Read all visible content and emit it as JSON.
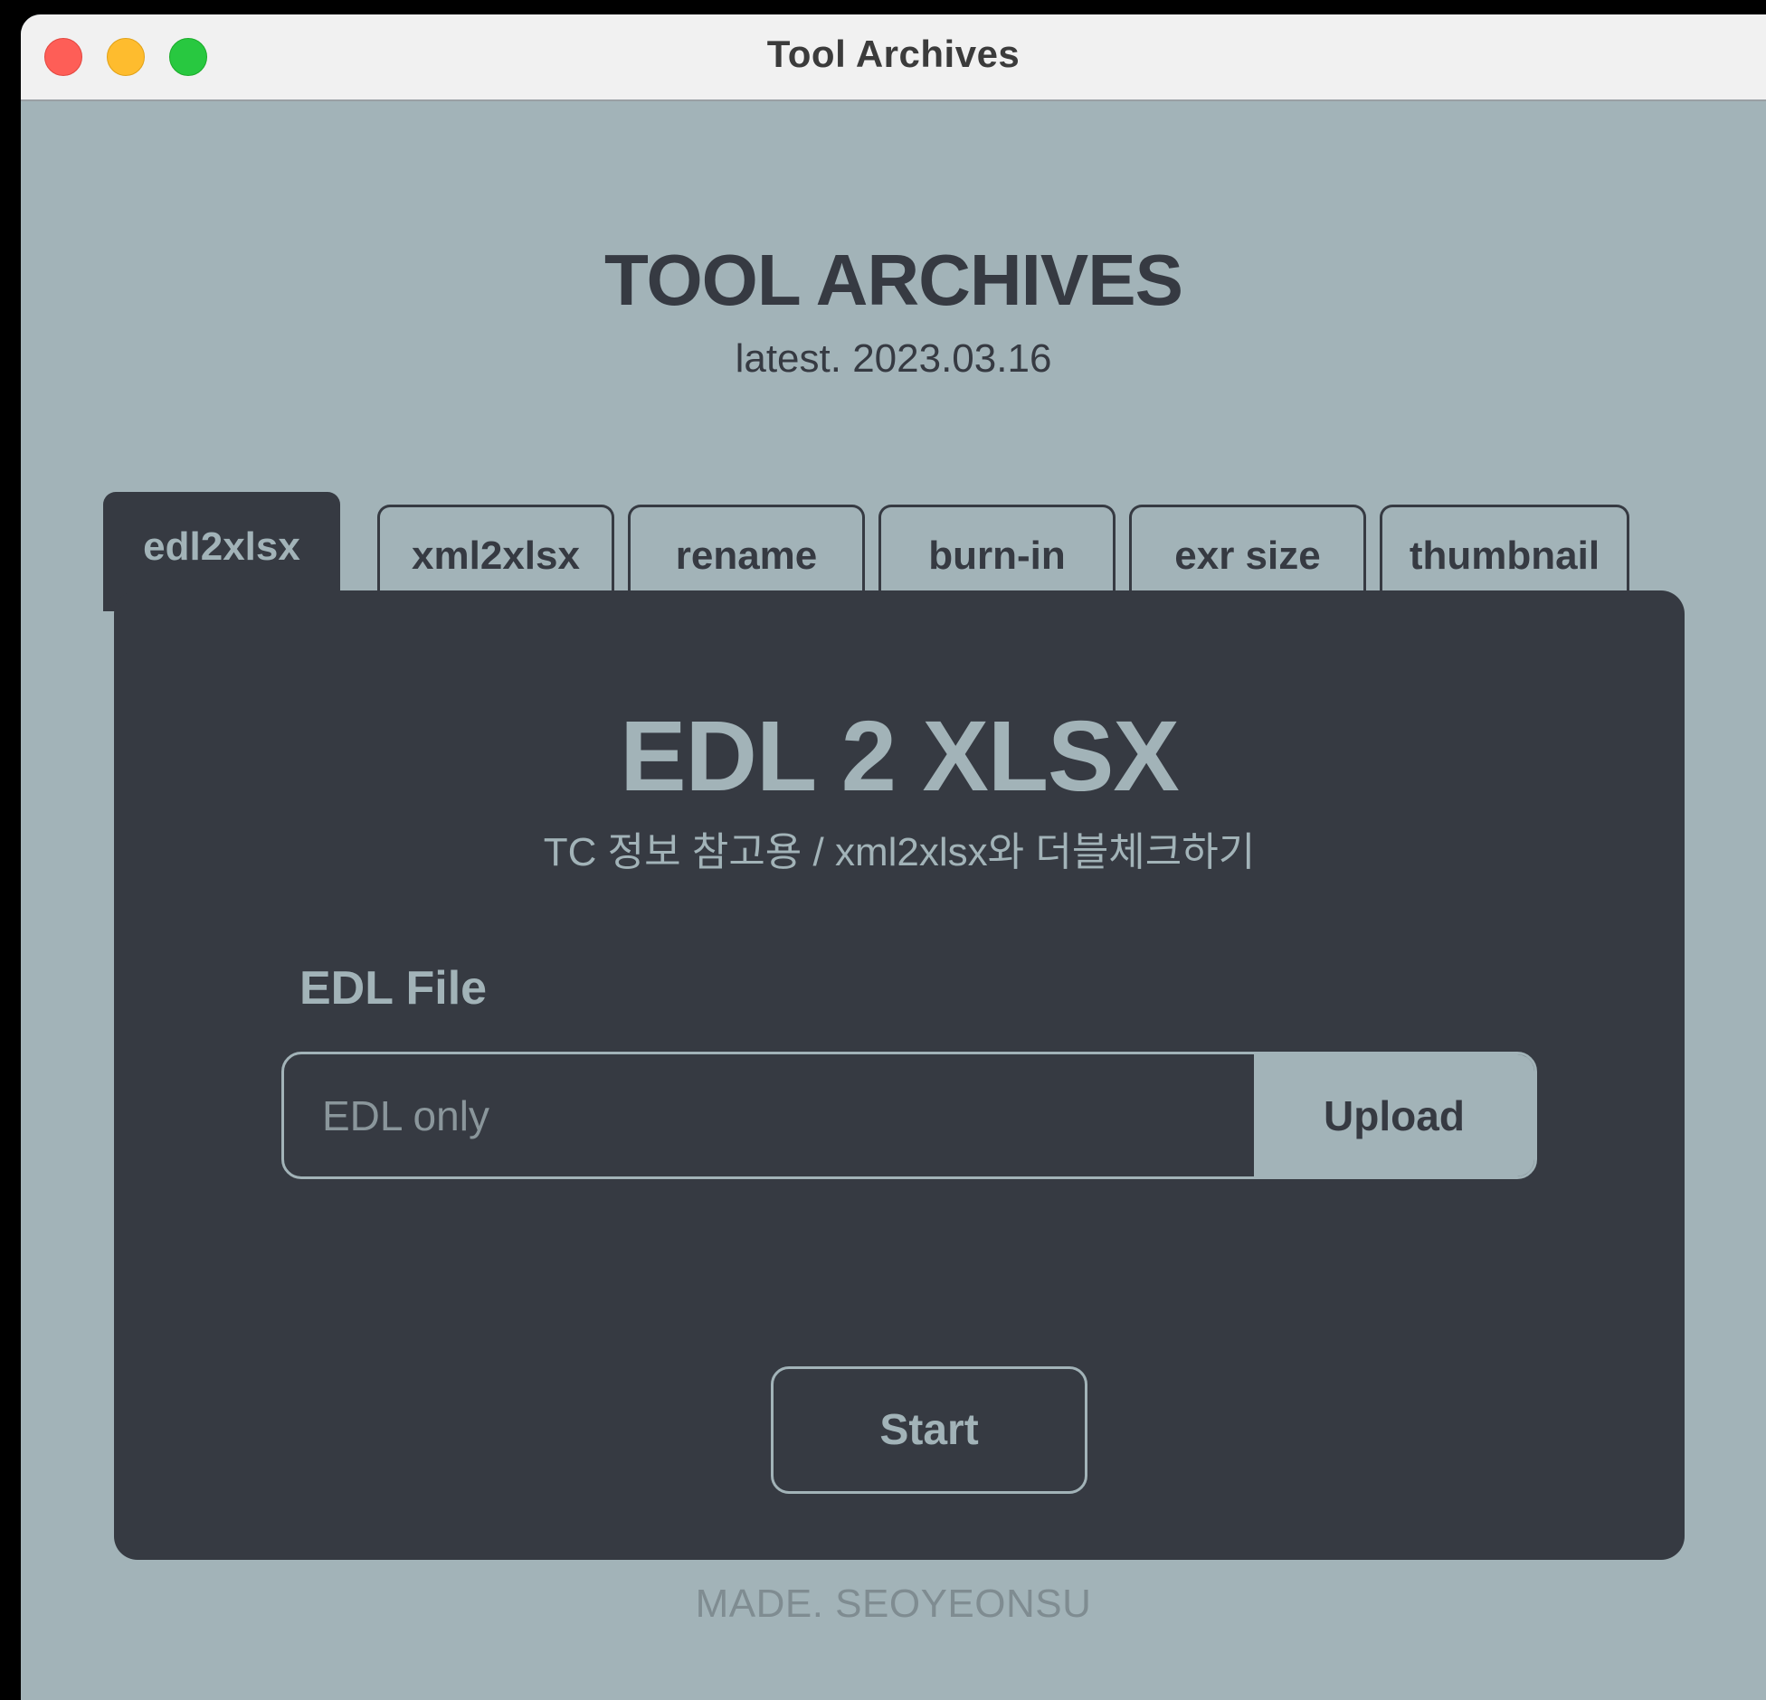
{
  "window": {
    "title": "Tool Archives"
  },
  "header": {
    "title": "TOOL ARCHIVES",
    "version": "latest. 2023.03.16"
  },
  "tabs": [
    {
      "label": "edl2xlsx",
      "active": true
    },
    {
      "label": "xml2xlsx",
      "active": false
    },
    {
      "label": "rename",
      "active": false
    },
    {
      "label": "burn-in",
      "active": false
    },
    {
      "label": "exr size",
      "active": false
    },
    {
      "label": "thumbnail",
      "active": false
    }
  ],
  "panel": {
    "title": "EDL 2 XLSX",
    "subtitle": "TC 정보 참고용 / xml2xlsx와 더블체크하기",
    "field_label": "EDL File",
    "file_input": {
      "placeholder": "EDL only",
      "value": ""
    },
    "upload_label": "Upload",
    "start_label": "Start"
  },
  "footer": {
    "credit": "MADE. SEOYEONSU"
  },
  "colors": {
    "background": "#a2b3b8",
    "panel": "#363a42",
    "accent_text": "#a2b3b8",
    "footer_text": "#7f8c91"
  }
}
